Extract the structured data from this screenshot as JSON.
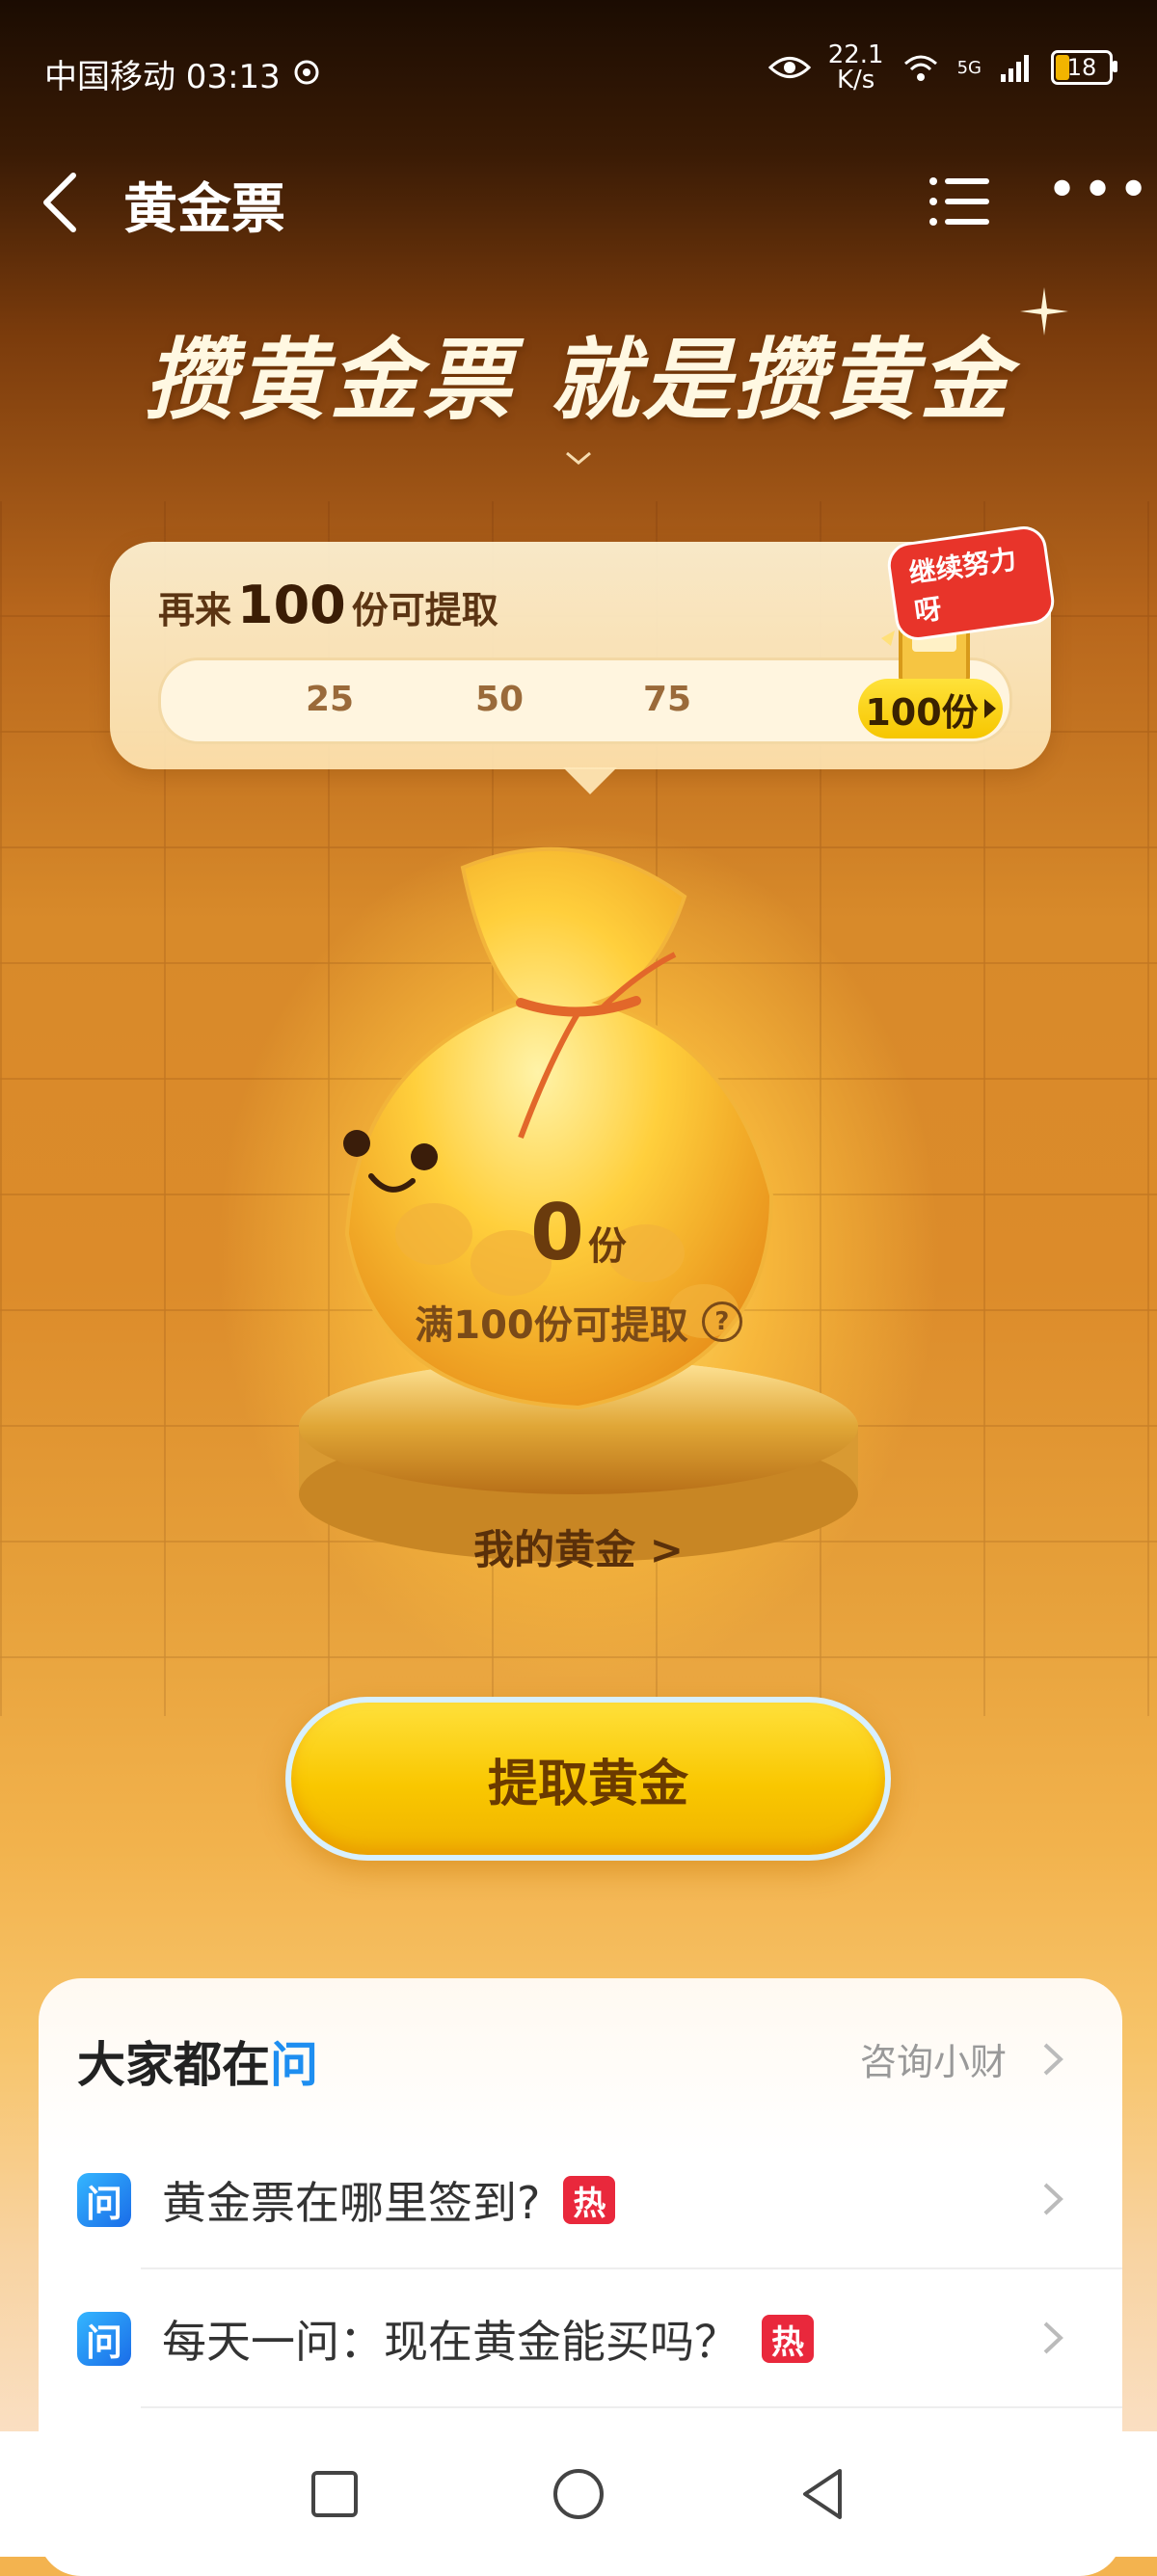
{
  "status_bar": {
    "carrier_time": "中国移动 03:13",
    "net_speed_value": "22.1",
    "net_speed_unit": "K/s",
    "signal_label": "5G",
    "battery": "18"
  },
  "nav": {
    "title": "黄金票",
    "more_label": "•••"
  },
  "headline": "攒黄金票 就是攒黄金",
  "progress": {
    "prefix": "再来",
    "remaining": "100",
    "suffix": "份可提取",
    "ticks": [
      "25",
      "50",
      "75"
    ],
    "goal": "100份",
    "sticker": "继续努力呀",
    "fraction": 0
  },
  "gold": {
    "amount": "0",
    "unit": "份",
    "hint": "满100份可提取",
    "help_icon": "?",
    "my_gold_link": "我的黄金 >"
  },
  "cta": {
    "label": "提取黄金"
  },
  "qa": {
    "title_prefix": "大家都在",
    "title_glyph": "问",
    "consult": "咨询小财",
    "icon_glyph": "问",
    "hot_badge": "热",
    "items": [
      {
        "question": "黄金票在哪里签到?"
      },
      {
        "question": "每天一问：现在黄金能买吗？"
      }
    ]
  },
  "colors": {
    "accent_yellow": "#f9c700",
    "hot_red": "#e9283c",
    "qa_blue": "#1e8ef0"
  }
}
